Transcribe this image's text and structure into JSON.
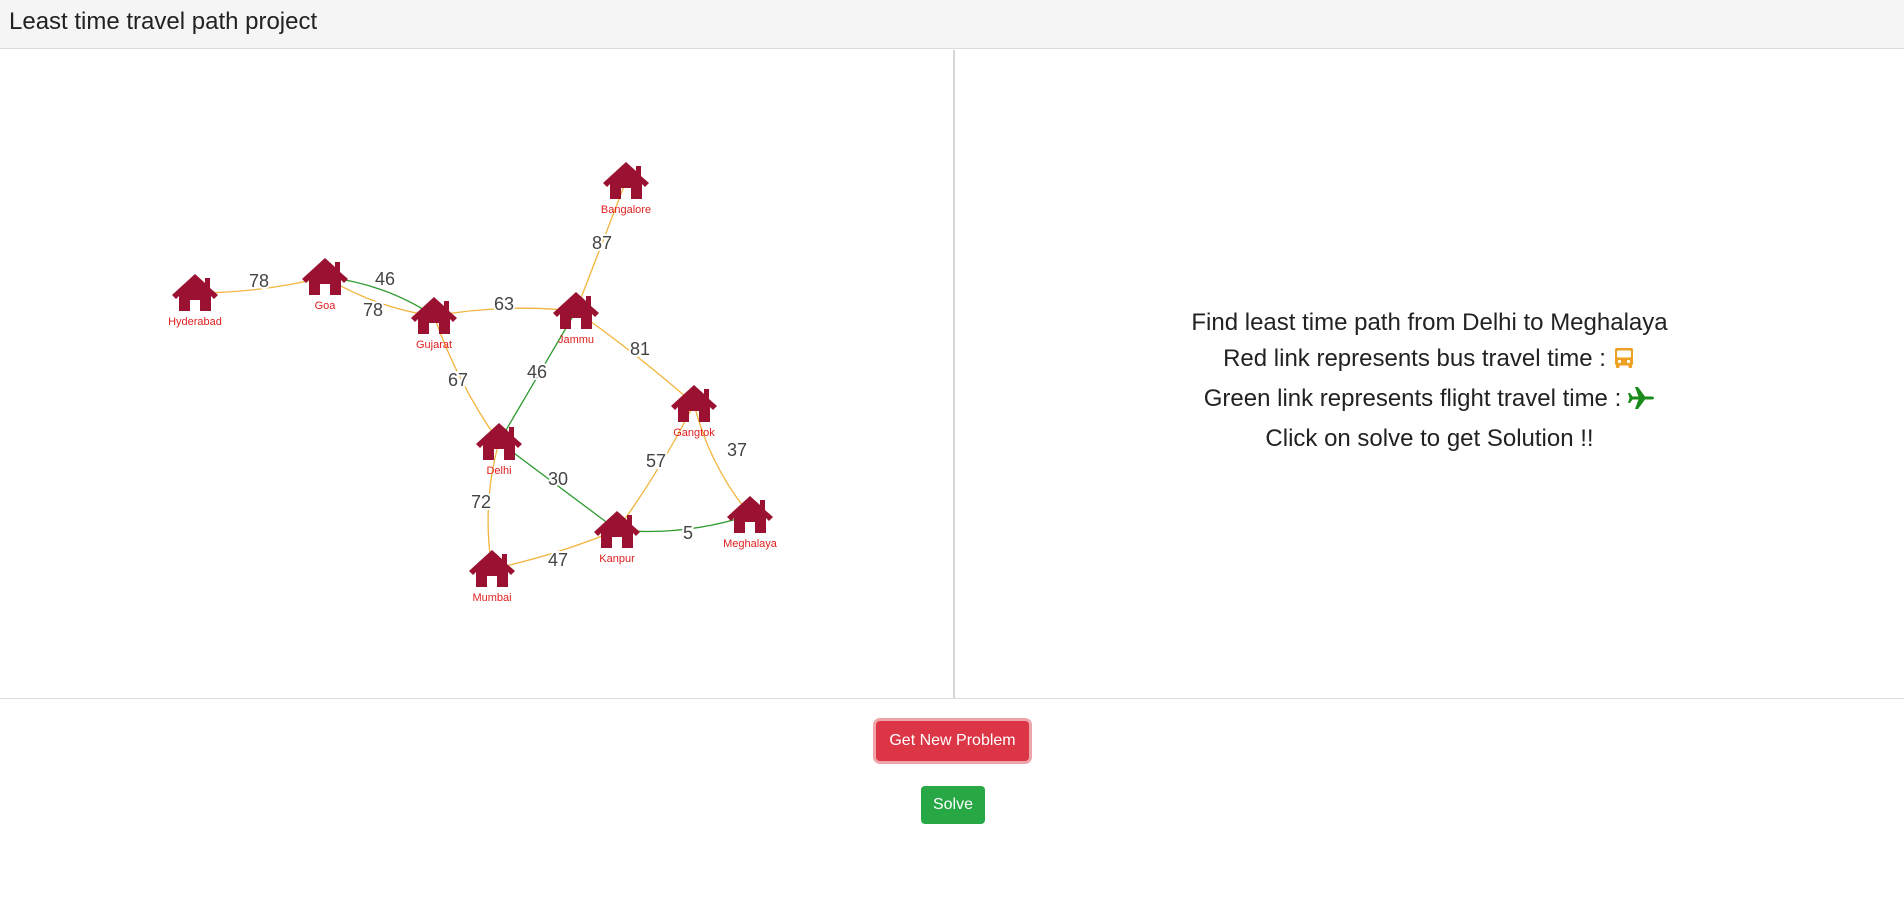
{
  "header": {
    "title": "Least time travel path project"
  },
  "graph": {
    "colors": {
      "node": "#9b1131",
      "node_label": "#e0201f",
      "bus_link": "#f2b43c",
      "flight_link": "#2e9a2e",
      "weight_label": "#444444"
    },
    "nodes": [
      {
        "id": "hyderabad",
        "label": "Hyderabad"
      },
      {
        "id": "goa",
        "label": "Goa"
      },
      {
        "id": "gujarat",
        "label": "Gujarat"
      },
      {
        "id": "jammu",
        "label": "Jammu"
      },
      {
        "id": "bangalore",
        "label": "Bangalore"
      },
      {
        "id": "gangtok",
        "label": "Gangtok"
      },
      {
        "id": "delhi",
        "label": "Delhi"
      },
      {
        "id": "kanpur",
        "label": "Kanpur"
      },
      {
        "id": "meghalaya",
        "label": "Meghalaya"
      },
      {
        "id": "mumbai",
        "label": "Mumbai"
      }
    ],
    "edges": [
      {
        "from": "hyderabad",
        "to": "goa",
        "weight": "78",
        "mode": "bus"
      },
      {
        "from": "goa",
        "to": "gujarat",
        "weight": "46",
        "mode": "flight"
      },
      {
        "from": "goa",
        "to": "gujarat",
        "weight": "78",
        "mode": "bus"
      },
      {
        "from": "gujarat",
        "to": "jammu",
        "weight": "63",
        "mode": "bus"
      },
      {
        "from": "bangalore",
        "to": "jammu",
        "weight": "87",
        "mode": "bus"
      },
      {
        "from": "gujarat",
        "to": "delhi",
        "weight": "67",
        "mode": "bus"
      },
      {
        "from": "jammu",
        "to": "delhi",
        "weight": "46",
        "mode": "flight"
      },
      {
        "from": "jammu",
        "to": "gangtok",
        "weight": "81",
        "mode": "bus"
      },
      {
        "from": "gangtok",
        "to": "meghalaya",
        "weight": "37",
        "mode": "bus"
      },
      {
        "from": "gangtok",
        "to": "kanpur",
        "weight": "57",
        "mode": "bus"
      },
      {
        "from": "delhi",
        "to": "kanpur",
        "weight": "30",
        "mode": "flight"
      },
      {
        "from": "kanpur",
        "to": "meghalaya",
        "weight": "5",
        "mode": "flight"
      },
      {
        "from": "delhi",
        "to": "mumbai",
        "weight": "72",
        "mode": "bus"
      },
      {
        "from": "mumbai",
        "to": "kanpur",
        "weight": "47",
        "mode": "bus"
      }
    ]
  },
  "info": {
    "line1": "Find least time path from Delhi to Meghalaya",
    "line2": "Red link represents bus travel time :",
    "line2_icon": "bus-icon",
    "line3": "Green link represents flight travel time :",
    "line3_icon": "airplane-icon",
    "line4": "Click on solve to get Solution !!",
    "bus_icon_color": "#f0a020",
    "plane_icon_color": "#1a8a1a"
  },
  "buttons": {
    "new_problem_label": "Get New Problem",
    "new_problem_color": "#dc3545",
    "solve_label": "Solve",
    "solve_color": "#28a745"
  }
}
